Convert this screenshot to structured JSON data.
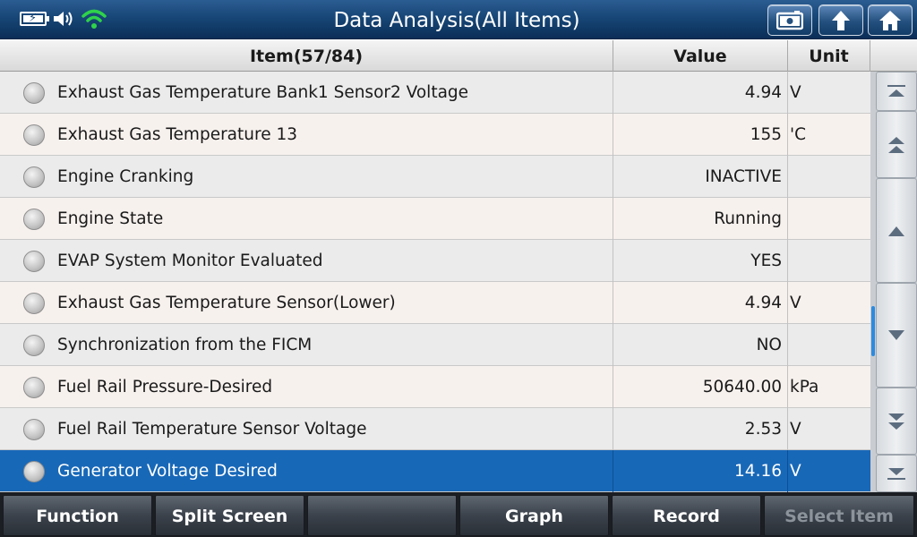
{
  "header": {
    "title": "Data Analysis(All Items)"
  },
  "table": {
    "columns": {
      "item": "Item(57/84)",
      "value": "Value",
      "unit": "Unit"
    },
    "rows": [
      {
        "name": "Exhaust Gas Temperature Bank1 Sensor2 Voltage",
        "value": "4.94",
        "unit": "V"
      },
      {
        "name": "Exhaust Gas Temperature 13",
        "value": "155",
        "unit": "'C"
      },
      {
        "name": "Engine Cranking",
        "value": "INACTIVE",
        "unit": ""
      },
      {
        "name": "Engine State",
        "value": "Running",
        "unit": ""
      },
      {
        "name": "EVAP System Monitor Evaluated",
        "value": "YES",
        "unit": ""
      },
      {
        "name": "Exhaust Gas Temperature Sensor(Lower)",
        "value": "4.94",
        "unit": "V"
      },
      {
        "name": "Synchronization from the FICM",
        "value": "NO",
        "unit": ""
      },
      {
        "name": "Fuel Rail Pressure-Desired",
        "value": "50640.00",
        "unit": "kPa"
      },
      {
        "name": "Fuel Rail Temperature Sensor Voltage",
        "value": "2.53",
        "unit": "V"
      },
      {
        "name": "Generator Voltage Desired",
        "value": "14.16",
        "unit": "V"
      }
    ],
    "selected_index": 9
  },
  "footer": {
    "function": "Function",
    "split_screen": "Split Screen",
    "empty": "",
    "graph": "Graph",
    "record": "Record",
    "select_item": "Select Item"
  },
  "colors": {
    "header_blue": "#174677",
    "selected_row": "#1868b8",
    "wifi_green": "#2fd34a"
  },
  "icons": [
    "battery-charging-icon",
    "speaker-icon",
    "wifi-icon",
    "screenshot-icon",
    "back-icon",
    "home-icon",
    "scroll-top-icon",
    "page-up-icon",
    "up-icon",
    "down-icon",
    "page-down-icon",
    "scroll-bottom-icon"
  ]
}
